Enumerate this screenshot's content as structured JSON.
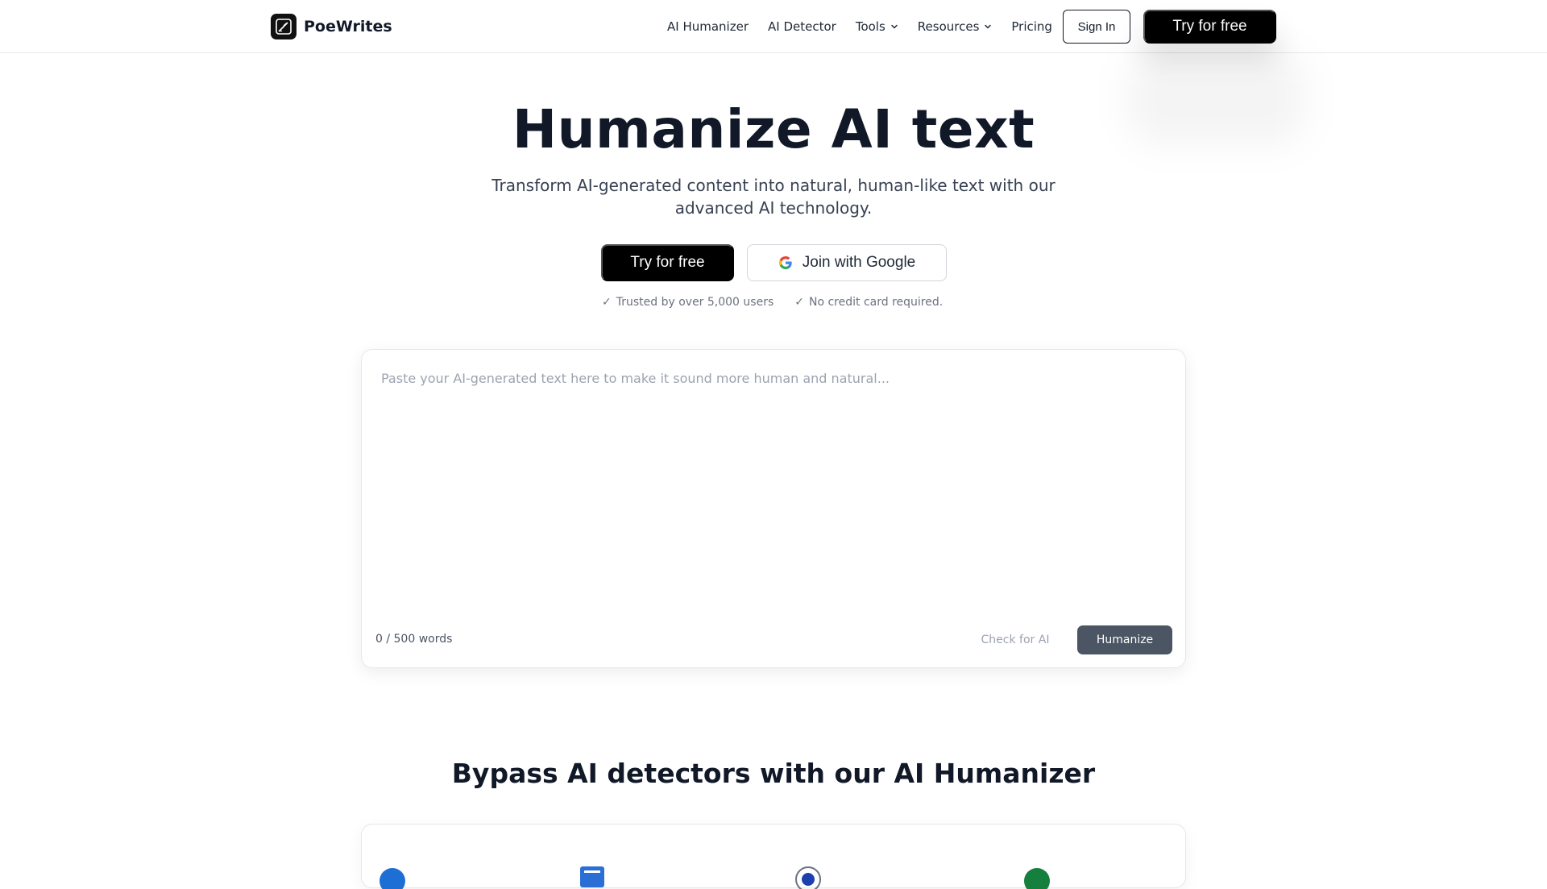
{
  "brand": {
    "name": "PoeWrites"
  },
  "nav": {
    "items": [
      {
        "label": "AI Humanizer"
      },
      {
        "label": "AI Detector"
      },
      {
        "label": "Tools"
      },
      {
        "label": "Resources"
      },
      {
        "label": "Pricing"
      }
    ],
    "sign_in": "Sign In",
    "try_free": "Try for free"
  },
  "hero": {
    "title": "Humanize AI text",
    "subtitle": "Transform AI-generated content into natural, human-like text with our advanced AI technology.",
    "try_free": "Try for free",
    "google": "Join with Google",
    "trust": [
      "Trusted by over 5,000 users",
      "No credit card required."
    ],
    "check_mark": "✓"
  },
  "editor": {
    "placeholder": "Paste your AI-generated text here to make it sound more human and natural...",
    "value": "",
    "word_count": "0 / 500 words",
    "check_ai": "Check for AI",
    "humanize": "Humanize"
  },
  "section": {
    "title": "Bypass AI detectors with our AI Humanizer"
  },
  "colors": {
    "primary": "#000000",
    "text": "#111827",
    "muted": "#6b7280",
    "humanize_button": "#4b5563",
    "border": "#e5e7eb"
  }
}
